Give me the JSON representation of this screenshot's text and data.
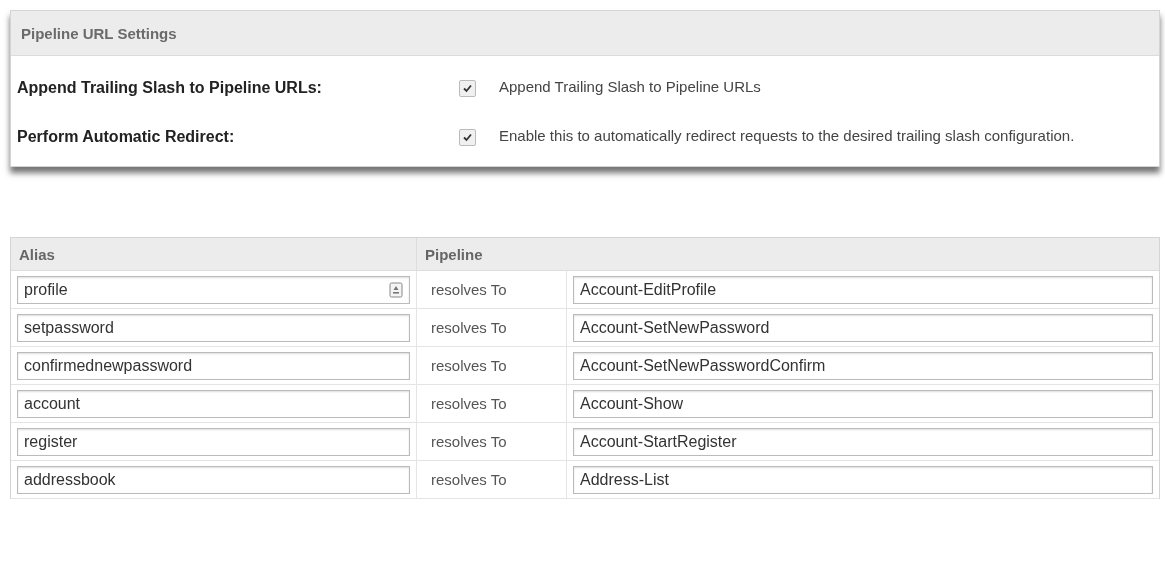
{
  "settings_panel": {
    "title": "Pipeline URL Settings",
    "rows": [
      {
        "label": "Append Trailing Slash to Pipeline URLs:",
        "checked": true,
        "description": "Append Trailing Slash to Pipeline URLs"
      },
      {
        "label": "Perform Automatic Redirect:",
        "checked": true,
        "description": "Enable this to automatically redirect requests to the desired trailing slash configuration."
      }
    ]
  },
  "table": {
    "columns": [
      "Alias",
      "Pipeline"
    ],
    "rows": [
      {
        "alias": "profile",
        "autofill_icon": true,
        "relation": "resolves To",
        "pipeline": "Account-EditProfile"
      },
      {
        "alias": "setpassword",
        "autofill_icon": false,
        "relation": "resolves To",
        "pipeline": "Account-SetNewPassword"
      },
      {
        "alias": "confirmednewpassword",
        "autofill_icon": false,
        "relation": "resolves To",
        "pipeline": "Account-SetNewPasswordConfirm"
      },
      {
        "alias": "account",
        "autofill_icon": false,
        "relation": "resolves To",
        "pipeline": "Account-Show"
      },
      {
        "alias": "register",
        "autofill_icon": false,
        "relation": "resolves To",
        "pipeline": "Account-StartRegister"
      },
      {
        "alias": "addressbook",
        "autofill_icon": false,
        "relation": "resolves To",
        "pipeline": "Address-List"
      }
    ]
  }
}
